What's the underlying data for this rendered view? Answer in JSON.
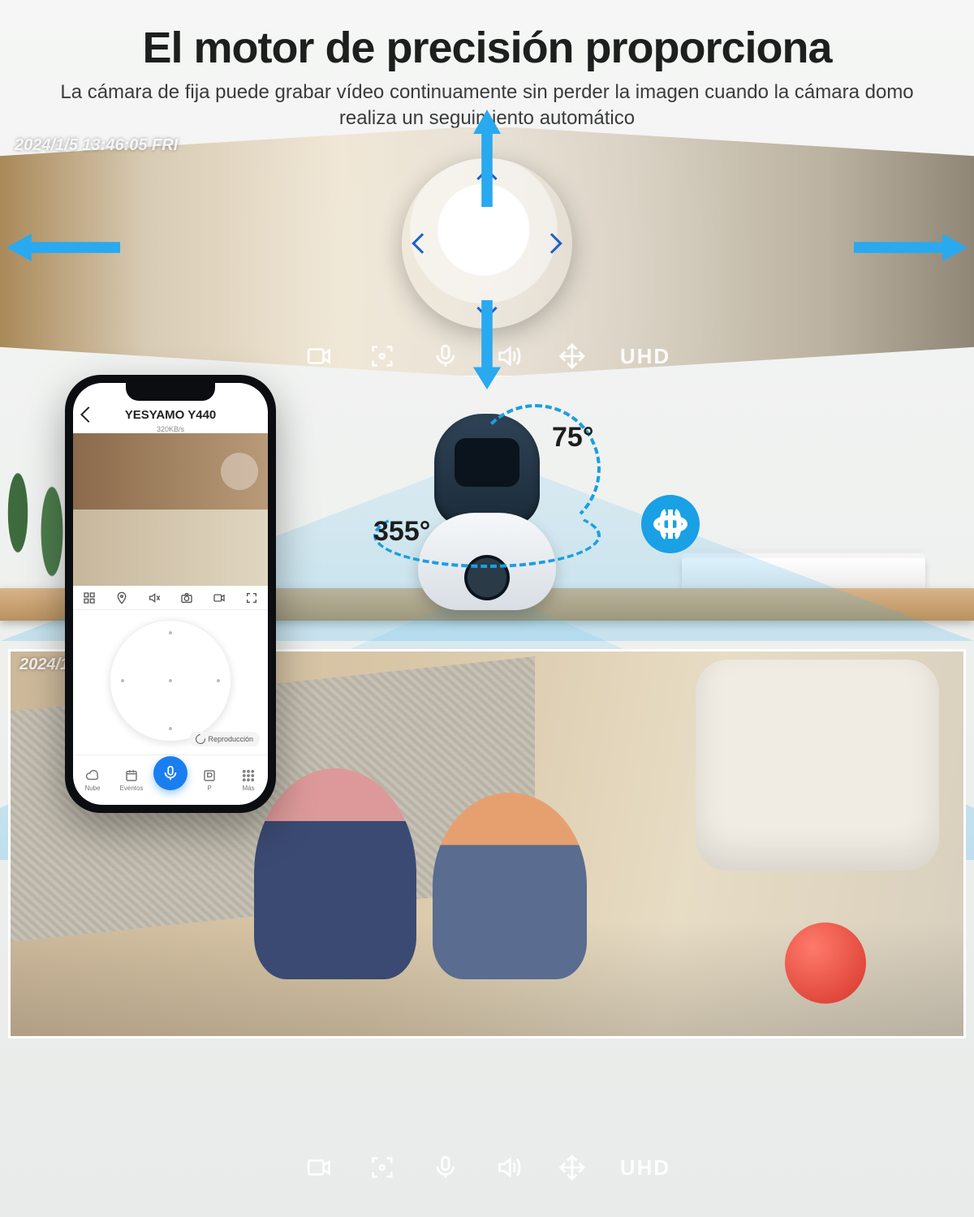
{
  "header": {
    "title": "El motor de precisión proporciona",
    "subtitle": "La cámara de fija puede grabar vídeo continuamente sin perder la imagen cuando la cámara domo realiza un seguimiento automático"
  },
  "overlay": {
    "timestamp_top": "2024/1/5 13:46:05 FRI",
    "timestamp_bottom": "2024/1/5 1",
    "resolution_label": "UHD",
    "icons": [
      "record",
      "focus",
      "mic",
      "speaker",
      "move"
    ]
  },
  "angles": {
    "tilt": "75°",
    "pan": "355°"
  },
  "phone": {
    "device_title": "YESYAMO Y440",
    "bitrate": "320KB/s",
    "playback_label": "Reproducción",
    "feed_icons": [
      "grid",
      "pin",
      "mute",
      "camera",
      "video",
      "fullscreen"
    ],
    "tabs": [
      {
        "id": "cloud",
        "label": "Nube"
      },
      {
        "id": "events",
        "label": "Eventos"
      },
      {
        "id": "mic",
        "label": ""
      },
      {
        "id": "p",
        "label": "P"
      },
      {
        "id": "more",
        "label": "Más"
      }
    ]
  }
}
